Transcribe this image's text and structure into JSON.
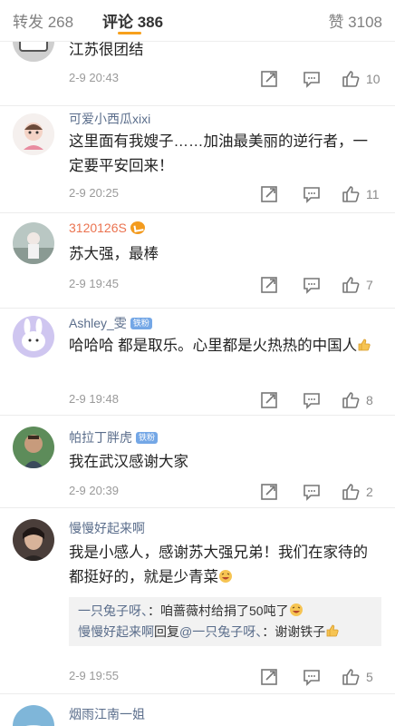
{
  "tabs": {
    "repost": "转发 268",
    "comments": "评论 386",
    "likes": "赞 3108"
  },
  "comments": [
    {
      "text": "江苏很团结",
      "time": "2-9 20:43",
      "likes": "10"
    },
    {
      "user": "可爱小西瓜xixi",
      "text": "这里面有我嫂子……加油最美丽的逆行者，一定要平安回来！",
      "time": "2-9 20:25",
      "likes": "11"
    },
    {
      "user": "3120126S",
      "text": "苏大强，最棒",
      "time": "2-9 19:45",
      "likes": "7"
    },
    {
      "user": "Ashley_雯",
      "badge": "铁粉",
      "text": "哈哈哈 都是取乐。心里都是火热热的中国人",
      "time": "2-9 19:48",
      "likes": "8"
    },
    {
      "user": "帕拉丁胖虎",
      "badge": "铁粉",
      "text": "我在武汉感谢大家",
      "time": "2-9 20:39",
      "likes": "2"
    },
    {
      "user": "慢慢好起来啊",
      "text": "我是小感人，感谢苏大强兄弟！我们在家待的都挺好的，就是少青菜",
      "time": "2-9 19:55",
      "likes": "5",
      "replies": [
        {
          "user": "一只兔子呀、",
          "text": "：咱蔷薇村给捐了50吨了"
        },
        {
          "user": "慢慢好起来啊",
          "mid": "回复",
          "target": "@一只兔子呀、",
          "text": "：谢谢铁子"
        }
      ]
    },
    {
      "user": "烟雨江南一姐"
    }
  ],
  "icons": {
    "share": "share-icon",
    "reply": "comment-icon",
    "like": "thumb-up-icon"
  },
  "colors": {
    "accent": "#f7a01c",
    "username": "#5a6d8b",
    "vip_username": "#eb7350"
  }
}
